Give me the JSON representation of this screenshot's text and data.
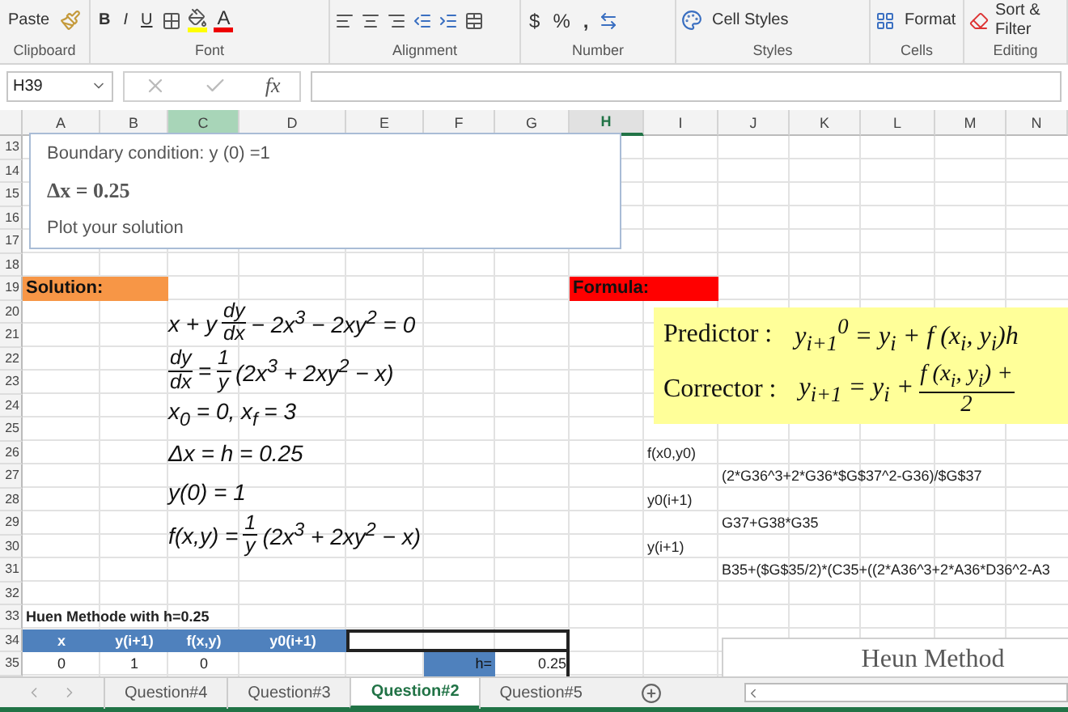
{
  "ribbon": {
    "paste": "Paste",
    "font_buttons": [
      "B",
      "I",
      "U"
    ],
    "font_color": "A",
    "number_buttons": [
      "$",
      "%",
      ","
    ],
    "cell_styles": "Cell Styles",
    "format": "Format",
    "sort": "Sort &",
    "filter": "Filter",
    "groups": [
      "Clipboard",
      "Font",
      "Alignment",
      "Number",
      "Styles",
      "Cells",
      "Editing"
    ]
  },
  "name_box": "H39",
  "fx": "fx",
  "columns": [
    {
      "label": "A",
      "selected": false,
      "highlighted": false
    },
    {
      "label": "B",
      "selected": false,
      "highlighted": false
    },
    {
      "label": "C",
      "selected": false,
      "highlighted": true
    },
    {
      "label": "D",
      "selected": false,
      "highlighted": false
    },
    {
      "label": "E",
      "selected": false,
      "highlighted": false
    },
    {
      "label": "F",
      "selected": false,
      "highlighted": false
    },
    {
      "label": "G",
      "selected": false,
      "highlighted": false
    },
    {
      "label": "H",
      "selected": true,
      "highlighted": false
    },
    {
      "label": "I",
      "selected": false,
      "highlighted": false
    },
    {
      "label": "J",
      "selected": false,
      "highlighted": false
    },
    {
      "label": "K",
      "selected": false,
      "highlighted": false
    },
    {
      "label": "L",
      "selected": false,
      "highlighted": false
    },
    {
      "label": "M",
      "selected": false,
      "highlighted": false
    },
    {
      "label": "N",
      "selected": false,
      "highlighted": false
    }
  ],
  "rows": [
    "13",
    "14",
    "15",
    "16",
    "17",
    "18",
    "19",
    "20",
    "21",
    "22",
    "23",
    "24",
    "25",
    "26",
    "27",
    "28",
    "29",
    "30",
    "31",
    "32",
    "33",
    "34",
    "35"
  ],
  "text_box": [
    {
      "kind": "text",
      "text": "Boundary condition: y (0) =1"
    },
    {
      "kind": "math",
      "text": "Δx = 0.25"
    },
    {
      "kind": "text",
      "text": "Plot your solution"
    }
  ],
  "cells": [
    {
      "kind": "heading",
      "text": "Solution:",
      "color": "#f79646"
    },
    {
      "kind": "heading",
      "text": "Formula:",
      "color": "#ff0000"
    },
    {
      "kind": "label",
      "text": "f(x0,y0)"
    },
    {
      "kind": "formula",
      "text": "(2*G36^3+2*G36*$G$37^2-G36)/$G$37"
    },
    {
      "kind": "label",
      "text": "y0(i+1)"
    },
    {
      "kind": "formula",
      "text": "G37+G38*G35"
    },
    {
      "kind": "label",
      "text": "y(i+1)"
    },
    {
      "kind": "formula",
      "text": "B35+($G$35/2)*(C35+((2*A36^3+2*A36*D36^2-A3"
    }
  ],
  "equations": [
    [
      {
        "kind": "text",
        "text": "x + y"
      },
      {
        "kind": "frac",
        "num": "dy",
        "den": "dx"
      },
      {
        "kind": "text",
        "text": "− 2x$^{3}$ − 2xy$^{2}$ = 0"
      }
    ],
    [
      {
        "kind": "frac",
        "num": "dy",
        "den": "dx"
      },
      {
        "kind": "text",
        "text": "="
      },
      {
        "kind": "frac",
        "num": "1",
        "den": "y"
      },
      {
        "kind": "text",
        "text": "(2x$^{3}$ + 2xy$^{2}$ − x)"
      }
    ],
    [
      {
        "kind": "text",
        "text": "x$_{0}$ = 0, x$_{f}$ = 3"
      }
    ],
    [
      {
        "kind": "text",
        "text": "Δx = h = 0.25"
      }
    ],
    [
      {
        "kind": "text",
        "text": "y(0) = 1"
      }
    ],
    [
      {
        "kind": "text",
        "text": "f(x,y) ="
      },
      {
        "kind": "frac",
        "num": "1",
        "den": "y"
      },
      {
        "kind": "text",
        "text": "(2x$^{3}$ + 2xy$^{2}$ − x)"
      }
    ]
  ],
  "formula_panel": [
    {
      "label": "Predictor :",
      "parts": [
        {
          "kind": "text",
          "text": "y$_{i+1}$$^{0}$ = y$_{i}$ + f (x$_{i}$, y$_{i}$)h"
        }
      ]
    },
    {
      "label": "Corrector :",
      "parts": [
        {
          "kind": "text",
          "text": "y$_{i+1}$ = y$_{i}$ +"
        },
        {
          "kind": "frac",
          "num": "f (x$_{i}$, y$_{i}$) +",
          "den": "2"
        }
      ]
    }
  ],
  "table": {
    "title": "Huen Methode with h=0.25",
    "columns": [
      "x",
      "y(i+1)",
      "f(x,y)",
      "y0(i+1)"
    ],
    "rows": [
      [
        "0",
        "1",
        "0"
      ]
    ]
  },
  "h_cell": {
    "label": "h=",
    "value": "0.25"
  },
  "chart": {
    "title": "Heun Method"
  },
  "sheet_tabs": [
    {
      "label": "Question#4",
      "selected": false
    },
    {
      "label": "Question#3",
      "selected": false
    },
    {
      "label": "Question#2",
      "selected": true
    },
    {
      "label": "Question#5",
      "selected": false
    }
  ]
}
